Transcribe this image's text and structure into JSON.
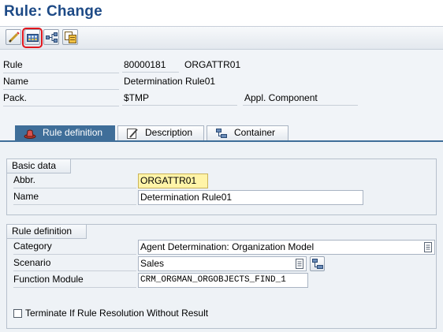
{
  "title": "Rule: Change",
  "toolbar": {
    "buttons": [
      {
        "name": "edit-pencil-icon"
      },
      {
        "name": "simulate-rule-icon",
        "highlighted": true
      },
      {
        "name": "org-structure-icon"
      },
      {
        "name": "copy-icon"
      }
    ]
  },
  "header": {
    "rule_label": "Rule",
    "rule_number": "80000181",
    "rule_abbr": "ORGATTR01",
    "name_label": "Name",
    "name_value": "Determination Rule01",
    "pack_label": "Pack.",
    "pack_value": "$TMP",
    "appl_label": "Appl. Component",
    "appl_value": ""
  },
  "tabs": [
    {
      "label": "Rule definition",
      "active": true,
      "icon": "hat-icon"
    },
    {
      "label": "Description",
      "active": false,
      "icon": "pencil-note-icon"
    },
    {
      "label": "Container",
      "active": false,
      "icon": "container-icon"
    }
  ],
  "basic_data": {
    "title": "Basic data",
    "abbr_label": "Abbr.",
    "abbr_value": "ORGATTR01",
    "name_label": "Name",
    "name_value": "Determination Rule01"
  },
  "rule_definition": {
    "title": "Rule definition",
    "category_label": "Category",
    "category_value": "Agent Determination: Organization Model",
    "scenario_label": "Scenario",
    "scenario_value": "Sales",
    "function_label": "Function Module",
    "function_value": "CRM_ORGMAN_ORGOBJECTS_FIND_1"
  },
  "terminate": {
    "label": "Terminate If Rule Resolution Without Result",
    "checked": false
  },
  "colors": {
    "title": "#1d4a86",
    "active_tab": "#3f6e99",
    "highlight": "#e0151c",
    "focus_field": "#fff4a8"
  }
}
